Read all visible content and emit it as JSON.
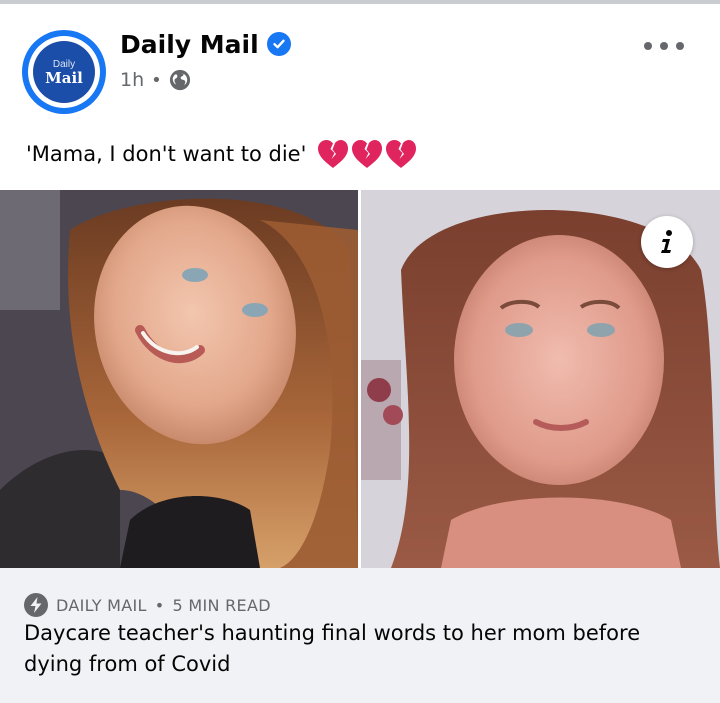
{
  "post": {
    "page_name": "Daily Mail",
    "time": "1h",
    "separator": "•",
    "caption": "'Mama, I don't want to die'",
    "avatar": {
      "top_text": "Daily",
      "main_text": "Mail"
    }
  },
  "link": {
    "source": "DAILY MAIL",
    "separator": "•",
    "read_time": "5 MIN READ",
    "title": "Daycare teacher's haunting final words to her mom before dying from of Covid"
  },
  "icons": {
    "verified": "verified-badge-icon",
    "audience": "globe-icon",
    "more": "more-options-icon",
    "emoji": "broken-heart-icon",
    "info": "info-icon",
    "source": "lightning-bolt-icon"
  },
  "colors": {
    "brand_blue": "#1877f2",
    "secondary_text": "#65676b",
    "link_background": "#f0f2f5",
    "broken_heart": "#e0245e"
  }
}
